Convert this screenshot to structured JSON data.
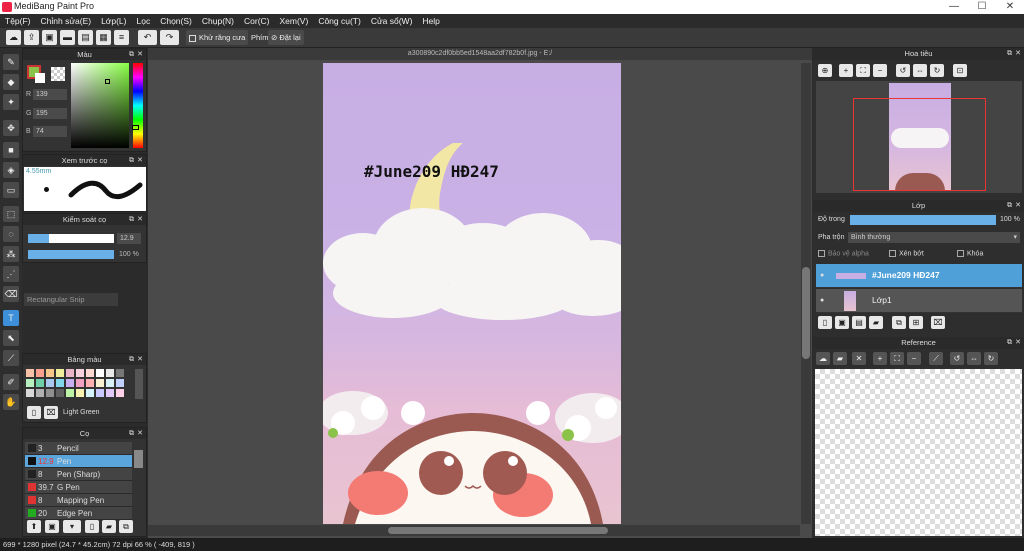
{
  "app": {
    "title": "MediBang Paint Pro",
    "min": "—",
    "max": "☐",
    "close": "✕"
  },
  "menu": [
    "Tệp(F)",
    "Chỉnh sửa(E)",
    "Lớp(L)",
    "Lọc",
    "Chọn(S)",
    "Chụp(N)",
    "Cor(C)",
    "Xem(V)",
    "Công cụ(T)",
    "Cửa sổ(W)",
    "Help"
  ],
  "toolbar": {
    "antialias": "Khử răng cưa",
    "phim": "Phím",
    "reset": "Đặt lại"
  },
  "color_panel": {
    "title": "Màu",
    "r_label": "R",
    "g_label": "G",
    "b_label": "B",
    "r": "139",
    "g": "195",
    "b": "74",
    "accent": "#8bc34a"
  },
  "brush_preview": {
    "title": "Xem trước cọ",
    "size": "4.55mm"
  },
  "brush_control": {
    "title": "Kiểm soát cọ",
    "size_val": "12.9",
    "opacity_val": "100 %"
  },
  "tooltip": "Rectangular Snip",
  "palette": {
    "title": "Bảng màu",
    "name": "Light Green"
  },
  "brushes": {
    "title": "Cọ",
    "items": [
      {
        "size": "3",
        "name": "Pencil",
        "color": "#222",
        "sel": false
      },
      {
        "size": "12.9",
        "name": "Pen",
        "color": "#111",
        "sel": true
      },
      {
        "size": "8",
        "name": "Pen (Sharp)",
        "color": "#222",
        "sel": false
      },
      {
        "size": "39.7",
        "name": "G Pen",
        "color": "#d33",
        "sel": false
      },
      {
        "size": "8",
        "name": "Mapping Pen",
        "color": "#d33",
        "sel": false
      },
      {
        "size": "20",
        "name": "Edge Pen",
        "color": "#2a2",
        "sel": false
      }
    ]
  },
  "document": {
    "tab": "a300890c2df0bb5ed1548aa2df782b0f.jpg - E:/",
    "canvas_text": "#June209 HĐ247"
  },
  "navigator": {
    "title": "Hoa tiêu"
  },
  "layers": {
    "title": "Lớp",
    "opacity_label": "Độ trong",
    "opacity_val": "100 %",
    "blend_label": "Pha trộn",
    "blend_val": "Bình thường",
    "protect_alpha": "Bảo vệ alpha",
    "clip": "Xén bớt",
    "lock": "Khóa",
    "items": [
      {
        "name": "#June209 HĐ247",
        "sel": true
      },
      {
        "name": "Lớp1",
        "sel": false
      }
    ]
  },
  "reference": {
    "title": "Reference"
  },
  "status": {
    "text": "699 * 1280 pixel  (24.7 * 45.2cm)  72 dpi  66 %  ( -409, 819 )"
  }
}
